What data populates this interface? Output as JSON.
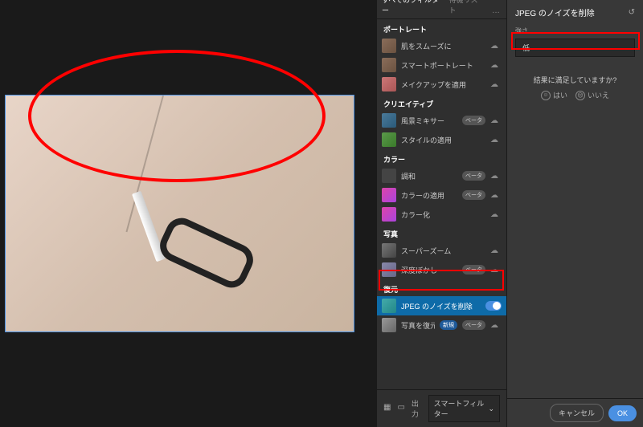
{
  "tabs": {
    "all_filters": "すべてのフィルター",
    "wait_list": "待機リスト"
  },
  "sections": {
    "portrait": "ポートレート",
    "creative": "クリエイティブ",
    "color": "カラー",
    "photo": "写真",
    "restore": "復元"
  },
  "filters": {
    "smooth_skin": "肌をスムーズに",
    "smart_portrait": "スマートポートレート",
    "makeup": "メイクアップを適用",
    "landscape_mixer": "風景ミキサー",
    "style_transfer": "スタイルの適用",
    "harmony": "調和",
    "color_transfer": "カラーの適用",
    "colorize": "カラー化",
    "super_zoom": "スーパーズーム",
    "depth_blur": "深度ぼかし",
    "jpeg_noise": "JPEG のノイズを削除",
    "photo_restore": "写真を復元"
  },
  "badges": {
    "beta": "ベータ",
    "new": "新規"
  },
  "options": {
    "panel_title": "JPEG のノイズを削除",
    "strength_label": "強さ",
    "strength_value": "低",
    "satisfaction_q": "結果に満足していますか?",
    "yes": "はい",
    "no": "いいえ"
  },
  "footer": {
    "output_label": "出力",
    "output_value": "スマートフィルター",
    "cancel": "キャンセル",
    "ok": "OK"
  }
}
